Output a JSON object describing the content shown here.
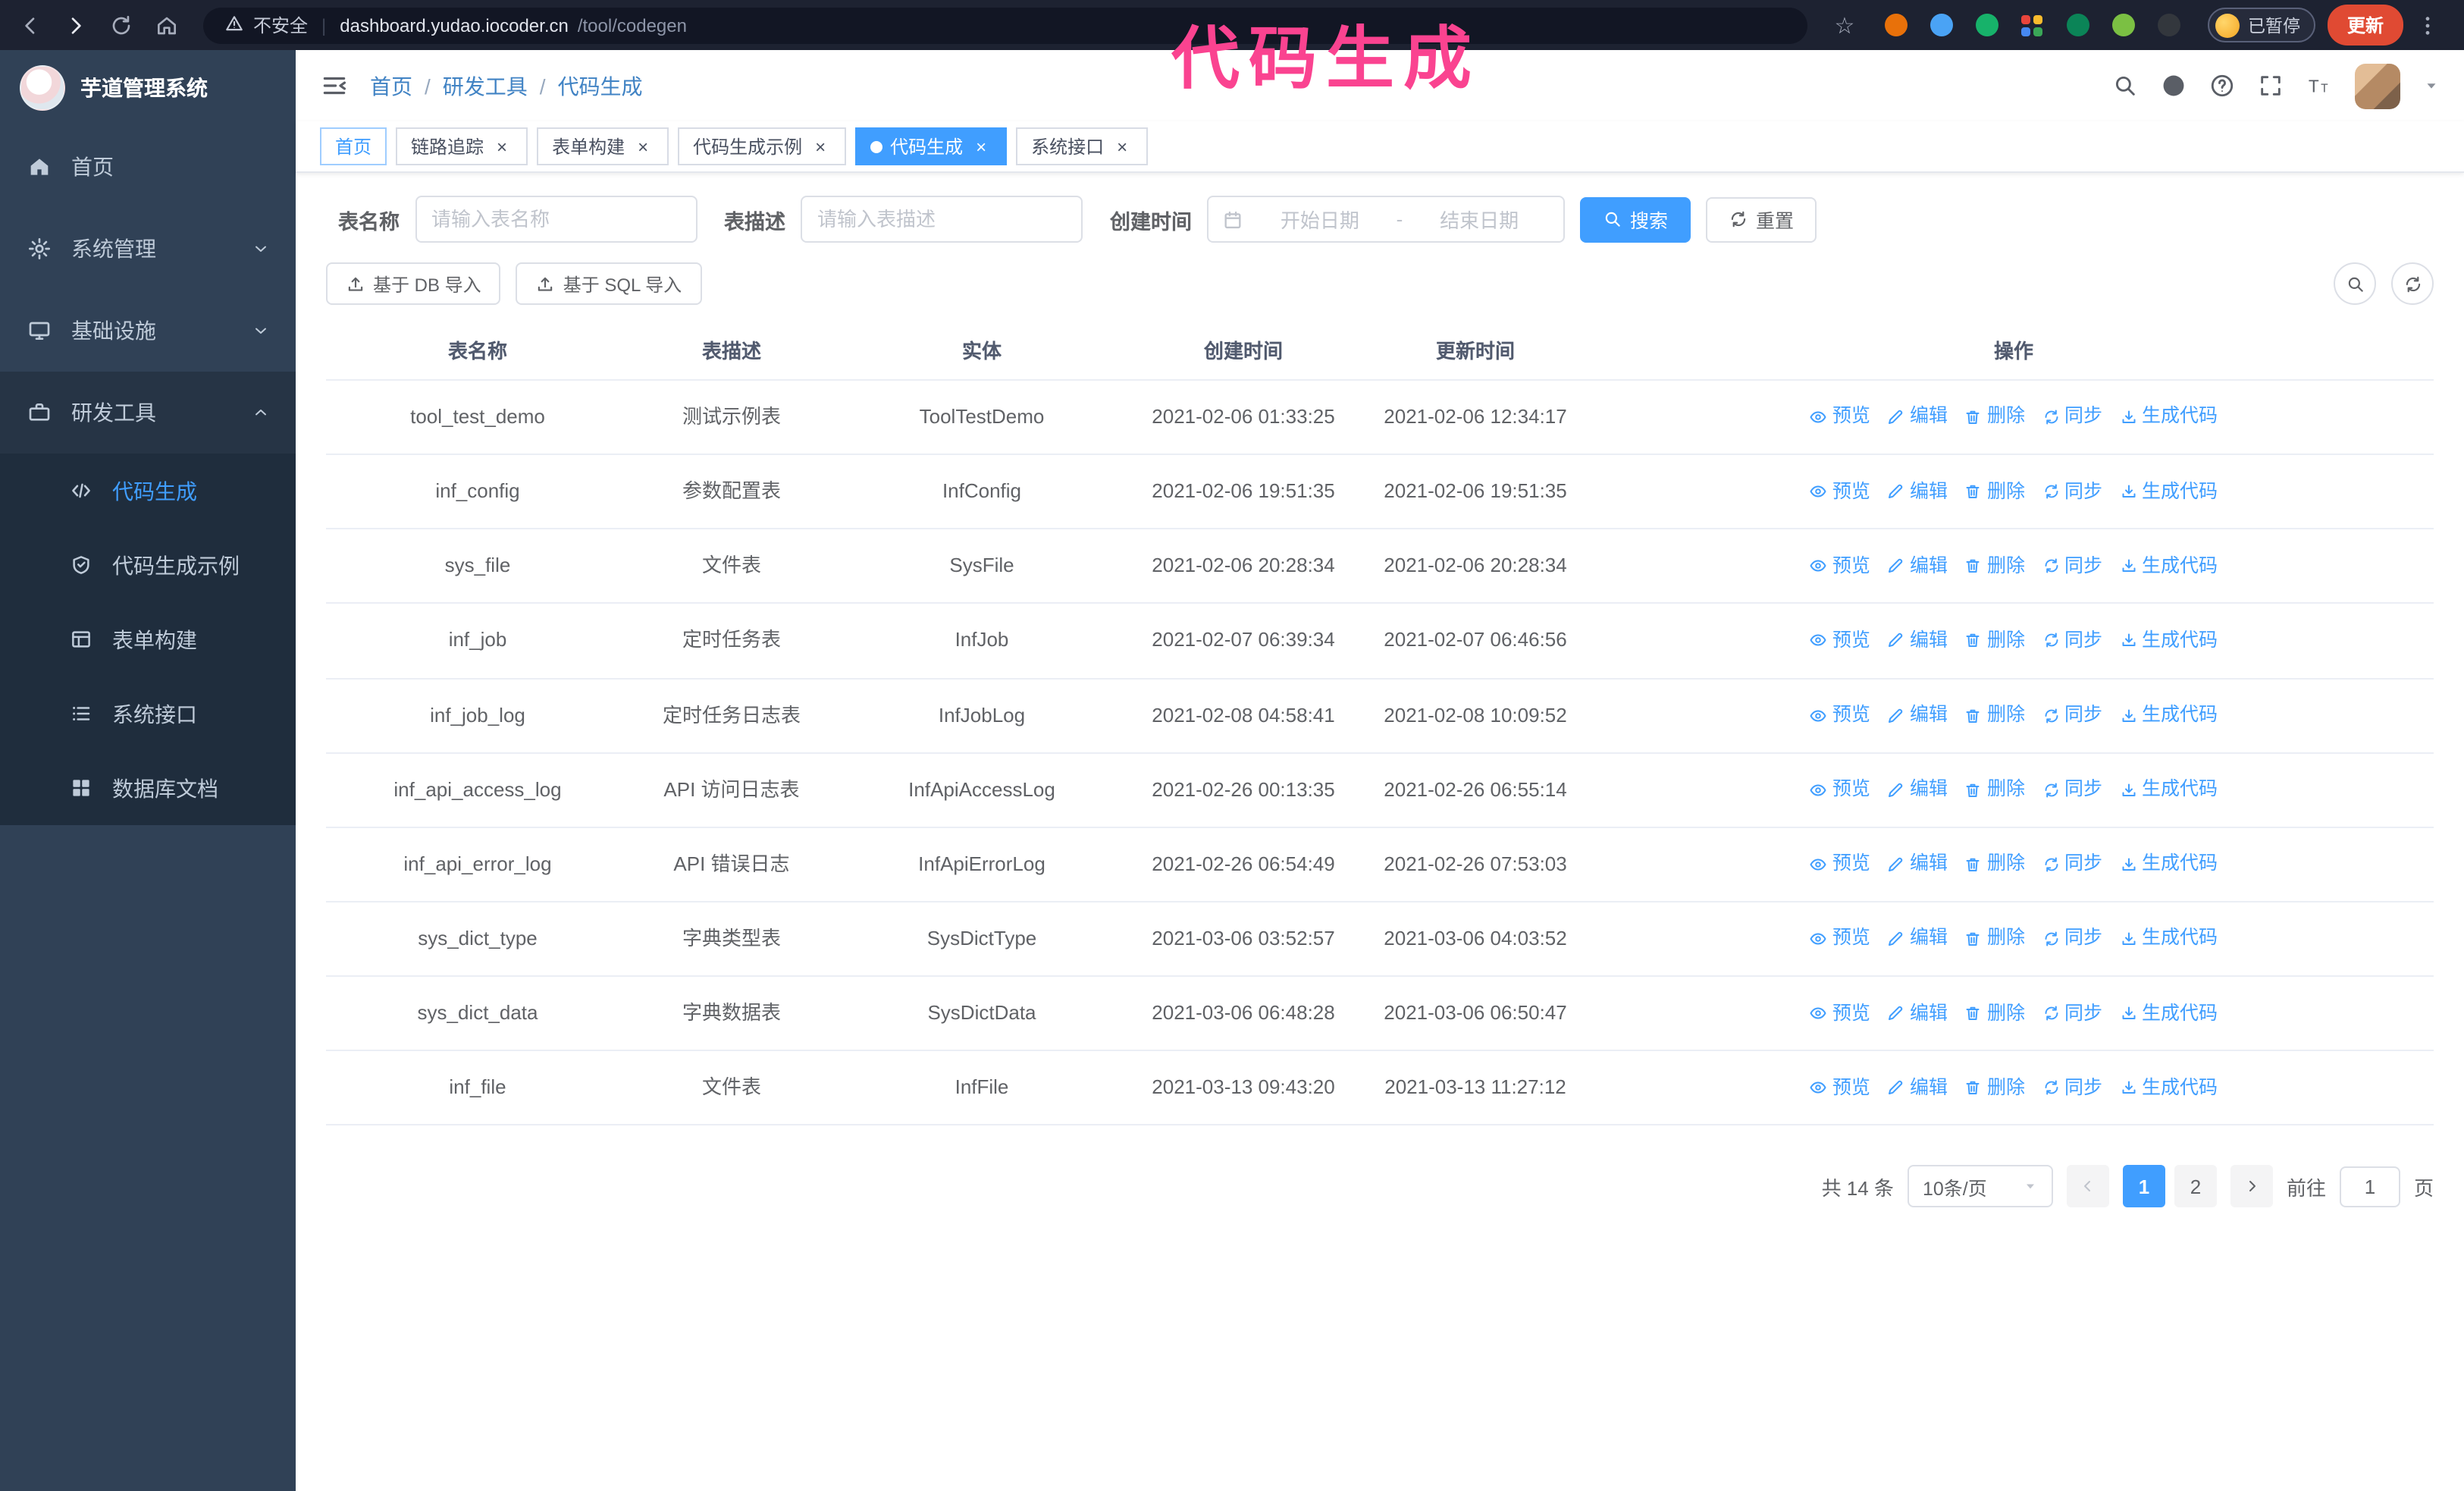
{
  "theme": {
    "accent": "#409eff",
    "sidebar_bg": "#304156",
    "submenu_bg": "#1f2d3d",
    "chrome_bg": "#1d2231",
    "update_button_color": "#e04a33"
  },
  "browser": {
    "security_label": "不安全",
    "url_host": "dashboard.yudao.iocoder.cn",
    "url_path": "/tool/codegen",
    "paused_badge_label": "已暂停",
    "update_button_label": "更新",
    "extensions": [
      "#e8710a",
      "#4aa3f5",
      "#17b26a",
      "multi",
      "#0b8457",
      "#7bc043",
      "#33373d"
    ]
  },
  "annotation": {
    "text": "代码生成",
    "color": "#fa4390"
  },
  "sidebar": {
    "logo_title": "芋道管理系统",
    "items": [
      {
        "label": "首页",
        "icon": "home-menu"
      },
      {
        "label": "系统管理",
        "icon": "gear",
        "chevron": "down"
      },
      {
        "label": "基础设施",
        "icon": "infra",
        "chevron": "down"
      },
      {
        "label": "研发工具",
        "icon": "tool",
        "chevron": "up",
        "open": true
      }
    ],
    "sub_items": [
      {
        "label": "代码生成",
        "icon": "code",
        "active": true
      },
      {
        "label": "代码生成示例",
        "icon": "example"
      },
      {
        "label": "表单构建",
        "icon": "form"
      },
      {
        "label": "系统接口",
        "icon": "api"
      },
      {
        "label": "数据库文档",
        "icon": "db"
      }
    ]
  },
  "header": {
    "breadcrumb": [
      "首页",
      "研发工具",
      "代码生成"
    ],
    "breadcrumb_separator": "/"
  },
  "tags": [
    {
      "label": "首页",
      "accent": true
    },
    {
      "label": "链路追踪",
      "closable": true
    },
    {
      "label": "表单构建",
      "closable": true
    },
    {
      "label": "代码生成示例",
      "closable": true
    },
    {
      "label": "代码生成",
      "active": true,
      "closable": true
    },
    {
      "label": "系统接口",
      "closable": true
    }
  ],
  "filters": {
    "table_name_label": "表名称",
    "table_name_placeholder": "请输入表名称",
    "table_desc_label": "表描述",
    "table_desc_placeholder": "请输入表描述",
    "create_time_label": "创建时间",
    "date_start_placeholder": "开始日期",
    "date_separator": "-",
    "date_end_placeholder": "结束日期",
    "search_button": "搜索",
    "reset_button": "重置"
  },
  "toolbar": {
    "db_import_button": "基于 DB 导入",
    "sql_import_button": "基于 SQL 导入"
  },
  "table": {
    "columns": [
      "表名称",
      "表描述",
      "实体",
      "创建时间",
      "更新时间",
      "操作"
    ],
    "row_actions": [
      {
        "label": "预览",
        "icon": "eye"
      },
      {
        "label": "编辑",
        "icon": "edit"
      },
      {
        "label": "删除",
        "icon": "delete"
      },
      {
        "label": "同步",
        "icon": "sync"
      },
      {
        "label": "生成代码",
        "icon": "download"
      }
    ],
    "rows": [
      {
        "name": "tool_test_demo",
        "desc": "测试示例表",
        "entity": "ToolTestDemo",
        "created": "2021-02-06 01:33:25",
        "updated": "2021-02-06 12:34:17"
      },
      {
        "name": "inf_config",
        "desc": "参数配置表",
        "entity": "InfConfig",
        "created": "2021-02-06 19:51:35",
        "updated": "2021-02-06 19:51:35"
      },
      {
        "name": "sys_file",
        "desc": "文件表",
        "entity": "SysFile",
        "created": "2021-02-06 20:28:34",
        "updated": "2021-02-06 20:28:34"
      },
      {
        "name": "inf_job",
        "desc": "定时任务表",
        "entity": "InfJob",
        "created": "2021-02-07 06:39:34",
        "updated": "2021-02-07 06:46:56"
      },
      {
        "name": "inf_job_log",
        "desc": "定时任务日志表",
        "entity": "InfJobLog",
        "created": "2021-02-08 04:58:41",
        "updated": "2021-02-08 10:09:52"
      },
      {
        "name": "inf_api_access_log",
        "desc": "API 访问日志表",
        "entity": "InfApiAccessLog",
        "created": "2021-02-26 00:13:35",
        "updated": "2021-02-26 06:55:14"
      },
      {
        "name": "inf_api_error_log",
        "desc": "API 错误日志",
        "entity": "InfApiErrorLog",
        "created": "2021-02-26 06:54:49",
        "updated": "2021-02-26 07:53:03"
      },
      {
        "name": "sys_dict_type",
        "desc": "字典类型表",
        "entity": "SysDictType",
        "created": "2021-03-06 03:52:57",
        "updated": "2021-03-06 04:03:52"
      },
      {
        "name": "sys_dict_data",
        "desc": "字典数据表",
        "entity": "SysDictData",
        "created": "2021-03-06 06:48:28",
        "updated": "2021-03-06 06:50:47"
      },
      {
        "name": "inf_file",
        "desc": "文件表",
        "entity": "InfFile",
        "created": "2021-03-13 09:43:20",
        "updated": "2021-03-13 11:27:12"
      }
    ]
  },
  "pagination": {
    "total_label": "共 14 条",
    "page_size_label": "10条/页",
    "pages": [
      "1",
      "2"
    ],
    "active_page": "1",
    "goto_prefix": "前往",
    "goto_value": "1",
    "goto_suffix": "页"
  }
}
